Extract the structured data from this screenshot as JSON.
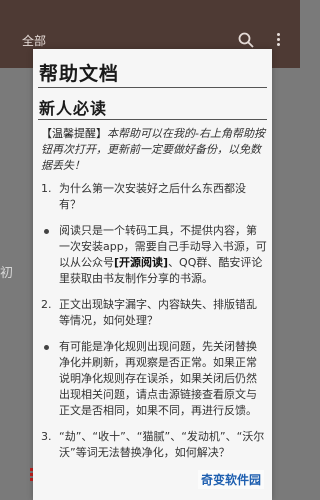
{
  "appbar": {
    "tab_label": "全部"
  },
  "background": {
    "partial_text": "初"
  },
  "dialog": {
    "title": "帮助文档",
    "section_title": "新人必读",
    "notice_tag": "【温馨提醒】",
    "notice_text": "本帮助可以在我的-右上角帮助按钮再次打开，更新前一定要做好备份，以免数据丢失！",
    "items": [
      {
        "marker": "1.",
        "text_before": "为什么第一次安装好之后什么东西都没有？",
        "bold": "",
        "text_after": ""
      },
      {
        "marker": "•",
        "text_before": "阅读只是一个转码工具，不提供内容，第一次安装app，需要自己手动导入书源，可以从公众号",
        "bold": "[开源阅读]",
        "text_after": "、QQ群、酷安评论里获取由书友制作分享的书源。"
      },
      {
        "marker": "2.",
        "text_before": "正文出现缺字漏字、内容缺失、排版错乱等情况，如何处理？",
        "bold": "",
        "text_after": ""
      },
      {
        "marker": "•",
        "text_before": "有可能是净化规则出现问题，先关闭替换净化并刷新，再观察是否正常。如果正常说明净化规则存在误杀，如果关闭后仍然出现相关问题，请点击源链接查看原文与正文是否相同，如果不同，再进行反馈。",
        "bold": "",
        "text_after": ""
      },
      {
        "marker": "3.",
        "text_before": "“劫”、“收十”、“猫腻”、“发动机”、“沃尔沃”等词无法替换净化，如何解决？",
        "bold": "",
        "text_after": ""
      }
    ]
  },
  "watermark": "奇变软件园"
}
